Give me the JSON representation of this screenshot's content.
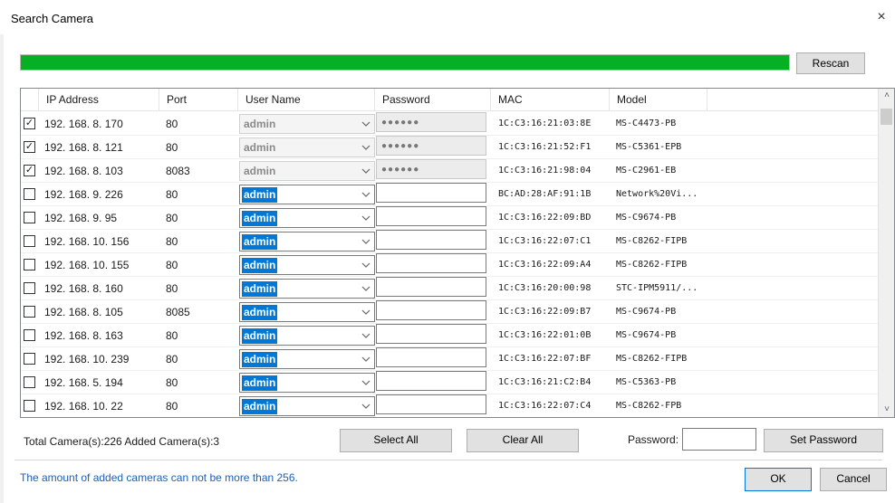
{
  "window": {
    "title": "Search Camera",
    "close_symbol": "×"
  },
  "progress": {
    "fraction": 1.0,
    "color": "#06b025"
  },
  "buttons": {
    "rescan": "Rescan",
    "select_all": "Select All",
    "clear_all": "Clear All",
    "set_password": "Set Password",
    "ok": "OK",
    "cancel": "Cancel"
  },
  "table": {
    "columns": [
      "IP Address",
      "Port",
      "User Name",
      "Password",
      "MAC",
      "Model"
    ],
    "rows": [
      {
        "checked": true,
        "added": true,
        "ip": "192. 168. 8. 170",
        "port": "80",
        "user": "admin",
        "password": "●●●●●●",
        "mac": "1C:C3:16:21:03:8E",
        "model": "MS-C4473-PB"
      },
      {
        "checked": true,
        "added": true,
        "ip": "192. 168. 8. 121",
        "port": "80",
        "user": "admin",
        "password": "●●●●●●",
        "mac": "1C:C3:16:21:52:F1",
        "model": "MS-C5361-EPB"
      },
      {
        "checked": true,
        "added": true,
        "ip": "192. 168. 8. 103",
        "port": "8083",
        "user": "admin",
        "password": "●●●●●●",
        "mac": "1C:C3:16:21:98:04",
        "model": "MS-C2961-EB"
      },
      {
        "checked": false,
        "added": false,
        "ip": "192. 168. 9. 226",
        "port": "80",
        "user": "admin",
        "password": "",
        "mac": "BC:AD:28:AF:91:1B",
        "model": "Network%20Vi..."
      },
      {
        "checked": false,
        "added": false,
        "ip": "192. 168. 9. 95",
        "port": "80",
        "user": "admin",
        "password": "",
        "mac": "1C:C3:16:22:09:BD",
        "model": "MS-C9674-PB"
      },
      {
        "checked": false,
        "added": false,
        "ip": "192. 168. 10. 156",
        "port": "80",
        "user": "admin",
        "password": "",
        "mac": "1C:C3:16:22:07:C1",
        "model": "MS-C8262-FIPB"
      },
      {
        "checked": false,
        "added": false,
        "ip": "192. 168. 10. 155",
        "port": "80",
        "user": "admin",
        "password": "",
        "mac": "1C:C3:16:22:09:A4",
        "model": "MS-C8262-FIPB"
      },
      {
        "checked": false,
        "added": false,
        "ip": "192. 168. 8. 160",
        "port": "80",
        "user": "admin",
        "password": "",
        "mac": "1C:C3:16:20:00:98",
        "model": "STC-IPM5911/..."
      },
      {
        "checked": false,
        "added": false,
        "ip": "192. 168. 8. 105",
        "port": "8085",
        "user": "admin",
        "password": "",
        "mac": "1C:C3:16:22:09:B7",
        "model": "MS-C9674-PB"
      },
      {
        "checked": false,
        "added": false,
        "ip": "192. 168. 8. 163",
        "port": "80",
        "user": "admin",
        "password": "",
        "mac": "1C:C3:16:22:01:0B",
        "model": "MS-C9674-PB"
      },
      {
        "checked": false,
        "added": false,
        "ip": "192. 168. 10. 239",
        "port": "80",
        "user": "admin",
        "password": "",
        "mac": "1C:C3:16:22:07:BF",
        "model": "MS-C8262-FIPB"
      },
      {
        "checked": false,
        "added": false,
        "ip": "192. 168. 5. 194",
        "port": "80",
        "user": "admin",
        "password": "",
        "mac": "1C:C3:16:21:C2:B4",
        "model": "MS-C5363-PB"
      },
      {
        "checked": false,
        "added": false,
        "ip": "192. 168. 10. 22",
        "port": "80",
        "user": "admin",
        "password": "",
        "mac": "1C:C3:16:22:07:C4",
        "model": "MS-C8262-FPB"
      }
    ]
  },
  "footer": {
    "totals": "Total Camera(s):226  Added Camera(s):3",
    "password_label": "Password:",
    "password_value": "",
    "limit_note": "The amount of added cameras can not be more than 256."
  },
  "icons": {
    "check": "check-icon",
    "dropdown": "chevron-down-icon",
    "scroll_up": "chevron-up-icon",
    "scroll_down": "chevron-down-icon"
  },
  "colors": {
    "progress": "#06b025",
    "selection": "#0078d7",
    "note_text": "#1d5fb8"
  }
}
